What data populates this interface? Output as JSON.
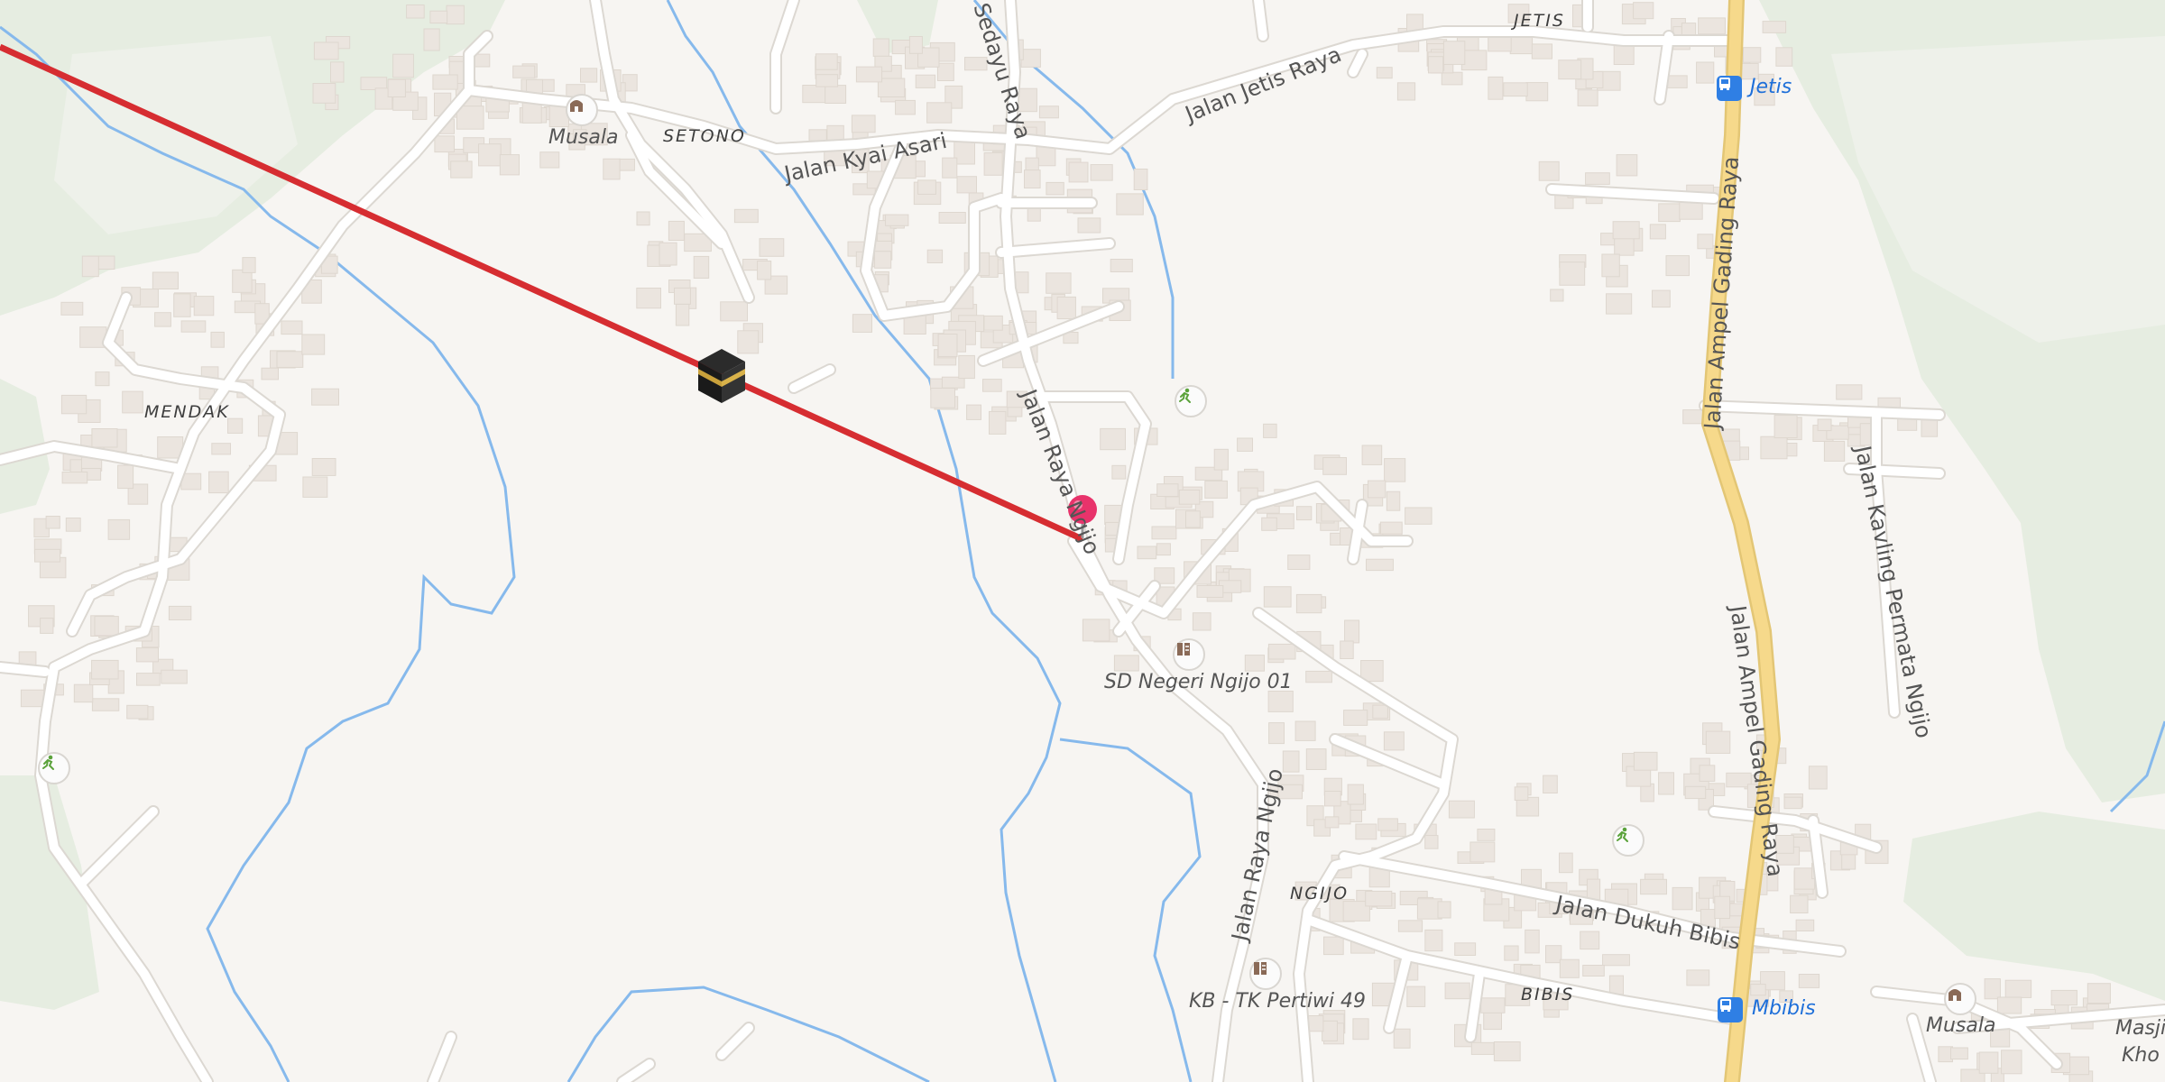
{
  "map": {
    "areas": {
      "setono": "SETONO",
      "jetis": "JETIS",
      "mendak": "MENDAK",
      "ngijo": "NGIJO",
      "bibis": "BIBIS"
    },
    "roads": {
      "jalan_jetis_raya": "Jalan Jetis Raya",
      "jalan_kyai_asari": "Jalan Kyai Asari",
      "sedayu_raya": "Sedayu Raya",
      "jalan_raya_ngijo_north": "Jalan Raya Ngijo",
      "jalan_raya_ngijo_south": "Jalan Raya Ngijo",
      "jalan_ampel_gading_raya_north": "Jalan Ampel Gading Raya",
      "jalan_ampel_gading_raya_south": "Jalan Ampel Gading Raya",
      "jalan_kavling_permata_ngijo": "Jalan Kavling Permata Ngijo",
      "jalan_dukuh_bibis": "Jalan Dukuh Bibis"
    },
    "pois": {
      "musala_1": "Musala",
      "musala_2": "Musala",
      "sd_negeri": "SD Negeri Ngijo 01",
      "kb_tk": "KB - TK Pertiwi 49",
      "masjid_partial": "Masji",
      "masjid_partial_2": "Kho"
    },
    "bus_stops": {
      "jetis": "Jetis",
      "mbibis": "Mbibis"
    },
    "colors": {
      "background": "#f7f5f2",
      "forest": "#e6ede1",
      "water": "#86b9ec",
      "road": "#ffffff",
      "road_casing": "#dcd8d2",
      "main_road": "#f6d98b",
      "building": "#ebe5df",
      "qibla_line": "#d62d31",
      "pin": "#e8336b",
      "bus_stop": "#2f7fe4",
      "park_icon": "#5aa23a"
    },
    "icons": {
      "kaaba": "kaaba-icon",
      "pin": "location-pin-icon",
      "bus": "bus-stop-icon",
      "mosque": "mosque-icon",
      "school": "school-icon",
      "park": "park-runner-icon"
    }
  }
}
